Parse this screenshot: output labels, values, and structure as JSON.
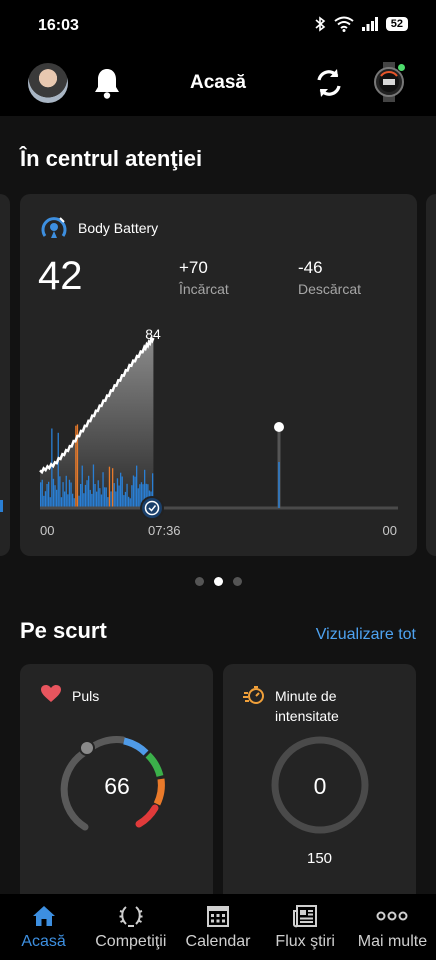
{
  "status_bar": {
    "time": "16:03",
    "battery": "52"
  },
  "header": {
    "title": "Acasă"
  },
  "spotlight": {
    "title": "În centrul atenţiei",
    "body_battery": {
      "title": "Body Battery",
      "current": "42",
      "charged_value": "+70",
      "charged_label": "Încărcat",
      "drained_value": "-46",
      "drained_label": "Descărcat"
    }
  },
  "chart_data": {
    "type": "area",
    "title": "Body Battery",
    "x_tick_labels": [
      "00",
      "07:36",
      "00"
    ],
    "peak_label": "84",
    "series": [
      {
        "x": [
          "00:00",
          "01:00",
          "02:00",
          "03:00",
          "04:00",
          "05:00",
          "06:00",
          "07:00",
          "07:36"
        ],
        "values": [
          18,
          22,
          30,
          40,
          50,
          60,
          70,
          79,
          84
        ]
      }
    ],
    "current_point": {
      "x": "16:00",
      "value": 42
    }
  },
  "pager": {
    "count": 3,
    "active": 1
  },
  "brief": {
    "title": "Pe scurt",
    "view_all": "Vizualizare tot",
    "heart_rate": {
      "title": "Puls",
      "value": "66"
    },
    "intensity": {
      "title_line1": "Minute de",
      "title_line2": "intensitate",
      "value": "0",
      "goal": "150"
    }
  },
  "nav": {
    "items": [
      {
        "label": "Acasă",
        "icon": "home-icon"
      },
      {
        "label": "Competiţii",
        "icon": "laurel-icon"
      },
      {
        "label": "Calendar",
        "icon": "calendar-icon"
      },
      {
        "label": "Flux ştiri",
        "icon": "newsfeed-icon"
      },
      {
        "label": "Mai multe",
        "icon": "more-icon"
      }
    ]
  },
  "colors": {
    "accent": "#3d8fe0",
    "link": "#4ea3f1",
    "heart": "#e8555e",
    "intensity": "#f0a03a",
    "chart_blue": "#2a7fd4",
    "chart_orange": "#e87a2a"
  }
}
